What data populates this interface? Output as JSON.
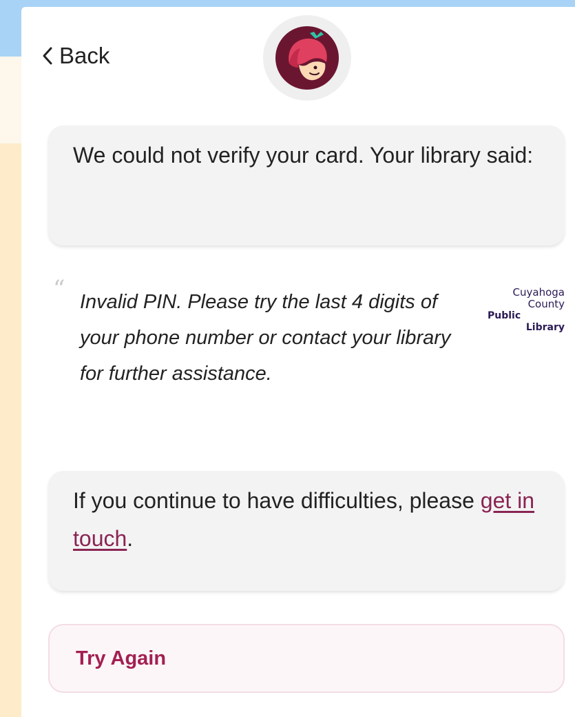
{
  "nav": {
    "back_label": "Back",
    "back_icon": "chevron-left-icon"
  },
  "app": {
    "avatar_icon": "libby-logo-icon"
  },
  "message": {
    "intro": "We could not verify your card. Your library said:"
  },
  "library_quote": {
    "quote_icon": "quote-mark-icon",
    "text": "Invalid PIN. Please try the last 4 digits of your phone number or contact your library for further assistance.",
    "library_logo": {
      "line1": "Cuyahoga",
      "line2": "County",
      "line3": "Public",
      "line4": "Library"
    }
  },
  "help": {
    "text_before": "If you continue to have difficulties, please",
    "link_label": "get in touch",
    "text_after": "."
  },
  "actions": {
    "try_again_label": "Try Again"
  },
  "colors": {
    "accent": "#a31f52",
    "link": "#8a2452",
    "card_bg": "#f3f3f4",
    "backdrop_blue": "#a8d3f6",
    "backdrop_cream": "#fdebc9",
    "avatar_maroon": "#6b1631"
  }
}
